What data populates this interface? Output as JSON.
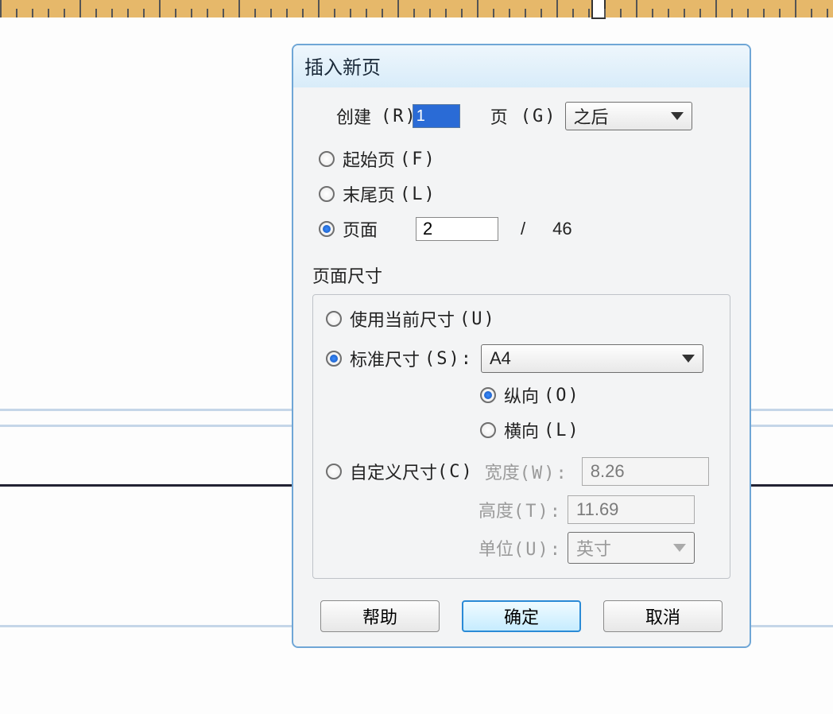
{
  "dialog": {
    "title": "插入新页",
    "create_label": "创建",
    "create_key": "(R)",
    "create_value": "1",
    "pages_label": "页",
    "pages_key": "(G)",
    "position_selected": "之后",
    "radios": {
      "first_page": "起始页",
      "first_key": "(F)",
      "last_page": "末尾页",
      "last_key": "(L)",
      "page": "页面"
    },
    "page_value": "2",
    "page_sep": "/",
    "page_total": "46",
    "size": {
      "legend": "页面尺寸",
      "use_current": "使用当前尺寸",
      "use_current_key": "(U)",
      "standard": "标准尺寸",
      "standard_key": "(S):",
      "standard_value": "A4",
      "orientation": {
        "portrait": "纵向",
        "portrait_key": "(O)",
        "landscape": "横向",
        "landscape_key": "(L)"
      },
      "custom": "自定义尺寸",
      "custom_key": "(C)",
      "width_label": "宽度",
      "width_key": "(W):",
      "width_value": "8.26",
      "height_label": "高度",
      "height_key": "(T):",
      "height_value": "11.69",
      "unit_label": "单位",
      "unit_key": "(U):",
      "unit_value": "英寸"
    },
    "buttons": {
      "help": "帮助",
      "ok": "确定",
      "cancel": "取消"
    }
  }
}
